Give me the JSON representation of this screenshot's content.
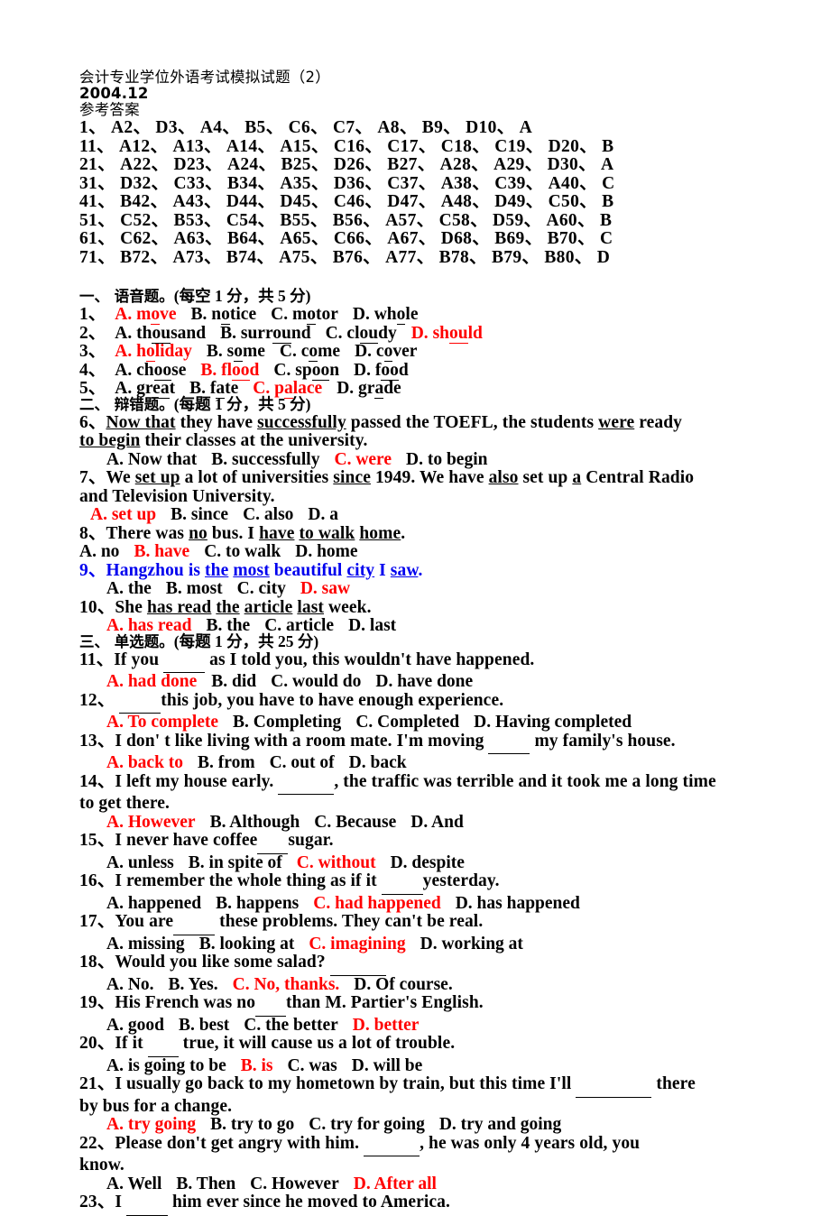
{
  "document": {
    "title": "会计专业学位外语考试模拟试题（2）",
    "date": "2004.12",
    "answer_key_heading": "参考答案"
  },
  "answer_key": {
    "rows": [
      "1、 A2、 D3、 A4、 B5、 C6、 C7、 A8、 B9、 D10、 A",
      "11、 A12、 A13、 A14、 A15、 C16、 C17、 C18、 C19、 D20、 B",
      "21、 A22、 D23、 A24、 B25、 D26、 B27、 A28、 A29、 D30、 A",
      "31、 D32、 C33、 B34、 A35、 D36、 C37、 A38、 C39、 A40、 C",
      "41、 B42、 A43、 D44、 D45、 C46、 D47、 A48、 D49、 C50、 B",
      "51、 C52、 B53、 C54、 B55、 B56、 A57、 C58、 D59、 A60、 B",
      "61、 C62、 A63、 B64、 A65、 C66、 A67、 D68、 B69、 B70、 C",
      "71、 B72、 A73、 B74、 A75、 B76、 A77、 B78、 B79、 B80、 D"
    ]
  },
  "sections": {
    "phonetics": {
      "heading_cn": "一、 语音题。",
      "heading_score": "(每空 1 分，共 5 分)",
      "items": [
        {
          "num": "1、",
          "options": [
            {
              "label": "A.",
              "pre": "m",
              "mark": "o",
              "post": "ve",
              "correct": true
            },
            {
              "label": "B.",
              "pre": "n",
              "mark": "o",
              "post": "tice",
              "correct": false
            },
            {
              "label": "C.",
              "pre": "m",
              "mark": "o",
              "post": "tor",
              "correct": false
            },
            {
              "label": "D.",
              "pre": "wh",
              "mark": "o",
              "post": "le",
              "correct": false
            }
          ]
        },
        {
          "num": "2、",
          "options": [
            {
              "label": "A.",
              "pre": "th",
              "mark": "ou",
              "post": "sand",
              "correct": false
            },
            {
              "label": "B.",
              "pre": "surr",
              "mark": "ou",
              "post": "nd",
              "correct": false
            },
            {
              "label": "C.",
              "pre": "cl",
              "mark": "ou",
              "post": "dy",
              "correct": false
            },
            {
              "label": "D.",
              "pre": "sh",
              "mark": "ou",
              "post": "ld",
              "correct": true
            }
          ]
        },
        {
          "num": "3、",
          "options": [
            {
              "label": "A.",
              "pre": "h",
              "mark": "o",
              "post": "liday",
              "correct": true
            },
            {
              "label": "B.",
              "pre": "s",
              "mark": "o",
              "post": "me",
              "correct": false
            },
            {
              "label": "C.",
              "pre": "c",
              "mark": "o",
              "post": "me",
              "correct": false
            },
            {
              "label": "D.",
              "pre": "c",
              "mark": "o",
              "post": "ver",
              "correct": false
            }
          ]
        },
        {
          "num": "4、",
          "options": [
            {
              "label": "A.",
              "pre": "ch",
              "mark": "oo",
              "post": "se",
              "correct": false
            },
            {
              "label": "B.",
              "pre": "fl",
              "mark": "oo",
              "post": "d",
              "correct": true
            },
            {
              "label": "C.",
              "pre": "sp",
              "mark": "oo",
              "post": "n",
              "correct": false
            },
            {
              "label": "D.",
              "pre": "f",
              "mark": "oo",
              "post": "d",
              "correct": false
            }
          ]
        },
        {
          "num": "5、",
          "options": [
            {
              "label": "A.",
              "pre": "gr",
              "mark": "ea",
              "post": "t",
              "correct": false
            },
            {
              "label": "B.",
              "pre": "f",
              "mark": "a",
              "post": "te",
              "correct": false
            },
            {
              "label": "C.",
              "pre": "p",
              "mark": "a",
              "post": "lace",
              "correct": true
            },
            {
              "label": "D.",
              "pre": "gr",
              "mark": "a",
              "post": "de",
              "correct": false
            }
          ]
        }
      ]
    },
    "error_correction": {
      "heading_cn": "二、 辩错题。",
      "heading_score": "(每题 1 分，共 5 分)",
      "items": [
        {
          "num": "6、",
          "stem_line1_a": "Now that",
          "stem_line1_b": " they have ",
          "stem_line1_c": "successfully",
          "stem_line1_d": " passed the TOEFL, the students  ",
          "stem_line1_e": "were",
          "stem_line1_f": " ready",
          "stem_line2_a": "to begin",
          "stem_line2_b": " their classes at the university.",
          "options": [
            {
              "label": "A.",
              "text": "Now that",
              "correct": false
            },
            {
              "label": "B.",
              "text": "successfully",
              "correct": false
            },
            {
              "label": "C.",
              "text": "were",
              "correct": true
            },
            {
              "label": "D.",
              "text": "to begin",
              "correct": false
            }
          ]
        },
        {
          "num": "7、",
          "stem_line1_a": "We ",
          "stem_line1_b": "set up",
          "stem_line1_c": " a lot of universities ",
          "stem_line1_d": "since",
          "stem_line1_e": " 1949. We have ",
          "stem_line1_f": "also",
          "stem_line1_g": " set up ",
          "stem_line1_h": "a",
          "stem_line1_i": " Central Radio",
          "stem_line2": "and Television University.",
          "options": [
            {
              "label": "A.",
              "text": "set up",
              "correct": true
            },
            {
              "label": "B.",
              "text": "since",
              "correct": false
            },
            {
              "label": "C.",
              "text": "also",
              "correct": false
            },
            {
              "label": "D.",
              "text": "a",
              "correct": false
            }
          ]
        },
        {
          "num": "8、",
          "stem_a": "There was ",
          "stem_b": "no",
          "stem_c": " bus. I ",
          "stem_d": "have",
          "stem_e": " ",
          "stem_f": "to walk",
          "stem_g": " ",
          "stem_h": "home",
          "stem_i": ".",
          "options": [
            {
              "label": "A.",
              "text": "no",
              "correct": false
            },
            {
              "label": "B.",
              "text": "have",
              "correct": true
            },
            {
              "label": "C.",
              "text": "to walk",
              "correct": false
            },
            {
              "label": "D.",
              "text": "home",
              "correct": false
            }
          ]
        },
        {
          "num": "9、",
          "blue": true,
          "stem_a": "Hangzhou is ",
          "stem_b": "the",
          "stem_c": " ",
          "stem_d": "most",
          "stem_e": " beautiful ",
          "stem_f": "city",
          "stem_g": " I ",
          "stem_h": "saw",
          "stem_i": ".",
          "options": [
            {
              "label": "A.",
              "text": "the",
              "correct": false
            },
            {
              "label": "B.",
              "text": "most",
              "correct": false
            },
            {
              "label": "C.",
              "text": "city",
              "correct": false
            },
            {
              "label": "D.",
              "text": "saw",
              "correct": true
            }
          ]
        },
        {
          "num": "10、",
          "stem_a": "She ",
          "stem_b": "has read",
          "stem_c": " ",
          "stem_d": "the",
          "stem_e": " ",
          "stem_f": "article",
          "stem_g": " ",
          "stem_h": "last",
          "stem_i": " week.",
          "options": [
            {
              "label": "A.",
              "text": "has read",
              "correct": true
            },
            {
              "label": "B.",
              "text": "the",
              "correct": false
            },
            {
              "label": "C.",
              "text": "article",
              "correct": false
            },
            {
              "label": "D.",
              "text": "last",
              "correct": false
            }
          ]
        }
      ]
    },
    "multiple_choice": {
      "heading_cn": "三、 单选题。",
      "heading_score": "(每题 1 分，共 25 分)",
      "items": [
        {
          "num": "11、",
          "stem_pre": "If you ",
          "blank": "b-md",
          "stem_post": " as I told you, this wouldn't have happened.",
          "options": [
            {
              "label": "A.",
              "text": "had done",
              "correct": true
            },
            {
              "label": "B.",
              "text": "did",
              "correct": false
            },
            {
              "label": "C.",
              "text": "would do",
              "correct": false
            },
            {
              "label": "D.",
              "text": "have done",
              "correct": false
            }
          ]
        },
        {
          "num": "12、",
          "stem_pre": " ",
          "blank": "b-md",
          "stem_post": "this job, you have to have enough experience.",
          "options": [
            {
              "label": "A.",
              "text": "To complete",
              "correct": true
            },
            {
              "label": "B.",
              "text": "Completing",
              "correct": false
            },
            {
              "label": "C.",
              "text": "Completed",
              "correct": false
            },
            {
              "label": "D.",
              "text": "Having completed",
              "correct": false
            }
          ]
        },
        {
          "num": "13、",
          "stem_pre": "I don' t like living with a room mate. I'm moving ",
          "blank": "b-md",
          "stem_post": " my family's house.",
          "options": [
            {
              "label": "A.",
              "text": "back to",
              "correct": true
            },
            {
              "label": "B.",
              "text": "from",
              "correct": false
            },
            {
              "label": "C.",
              "text": "out of",
              "correct": false
            },
            {
              "label": "D.",
              "text": "back",
              "correct": false
            }
          ]
        },
        {
          "num": "14、",
          "stem_pre": "I left my house early.  ",
          "blank": "b-lg",
          "stem_post": ", the traffic was terrible and it took me a long time",
          "stem_line2": "to get there.",
          "options": [
            {
              "label": "A.",
              "text": "However",
              "correct": true
            },
            {
              "label": "B.",
              "text": "Although",
              "correct": false
            },
            {
              "label": "C.",
              "text": "Because",
              "correct": false
            },
            {
              "label": "D.",
              "text": "And",
              "correct": false
            }
          ]
        },
        {
          "num": "15、",
          "stem_pre": "I never have coffee",
          "blank": "b-sm",
          "stem_post": "sugar.",
          "options": [
            {
              "label": "A.",
              "text": "unless",
              "correct": false
            },
            {
              "label": "B.",
              "text": "in spite of",
              "correct": false
            },
            {
              "label": "C.",
              "text": "without",
              "correct": true
            },
            {
              "label": "D.",
              "text": "despite",
              "correct": false
            }
          ]
        },
        {
          "num": "16、",
          "stem_pre": "I remember the whole thing as if it ",
          "blank": "b-md",
          "stem_post": "yesterday.",
          "options": [
            {
              "label": "A.",
              "text": "happened",
              "correct": false
            },
            {
              "label": "B.",
              "text": "happens",
              "correct": false
            },
            {
              "label": "C.",
              "text": "had happened",
              "correct": true
            },
            {
              "label": "D.",
              "text": "has happened",
              "correct": false
            }
          ]
        },
        {
          "num": "17、",
          "stem_pre": "You are",
          "blank": "b-md",
          "stem_post": " these problems. They can't be real.",
          "options": [
            {
              "label": "A.",
              "text": "missing",
              "correct": false
            },
            {
              "label": "B.",
              "text": "looking at",
              "correct": false
            },
            {
              "label": "C.",
              "text": "imagining",
              "correct": true
            },
            {
              "label": "D.",
              "text": "working at",
              "correct": false
            }
          ]
        },
        {
          "num": "18、",
          "stem_pre": "Would you like some salad? ",
          "blank": "b-lg",
          "stem_post": "",
          "options": [
            {
              "label": "A.",
              "text": "No.",
              "correct": false
            },
            {
              "label": "B.",
              "text": "Yes.",
              "correct": false
            },
            {
              "label": "C.",
              "text": "No, thanks.",
              "correct": true
            },
            {
              "label": "D.",
              "text": "Of course.",
              "correct": false
            }
          ]
        },
        {
          "num": "19、",
          "stem_pre": "His French was no",
          "blank": "b-sm",
          "stem_post": "than M. Partier's English.",
          "options": [
            {
              "label": "A.",
              "text": "good",
              "correct": false
            },
            {
              "label": "B.",
              "text": "best",
              "correct": false
            },
            {
              "label": "C.",
              "text": "the better",
              "correct": false
            },
            {
              "label": "D.",
              "text": "better",
              "correct": true
            }
          ]
        },
        {
          "num": "20、",
          "stem_pre": "If it ",
          "blank": "b-sm",
          "stem_post": " true, it will cause us a lot of trouble.",
          "options": [
            {
              "label": "A.",
              "text": "is going to be",
              "correct": false
            },
            {
              "label": "B.",
              "text": "is",
              "correct": true
            },
            {
              "label": "C.",
              "text": "was",
              "correct": false
            },
            {
              "label": "D.",
              "text": "will be",
              "correct": false
            }
          ]
        },
        {
          "num": "21、",
          "stem_pre": "I usually go back to my hometown by train, but this time I'll ",
          "blank": "b-xl",
          "stem_post": " there",
          "stem_line2": "by bus for a change.",
          "options": [
            {
              "label": "A.",
              "text": "try going",
              "correct": true
            },
            {
              "label": "B.",
              "text": "try to go",
              "correct": false
            },
            {
              "label": "C.",
              "text": "try for going",
              "correct": false
            },
            {
              "label": "D.",
              "text": "try and going",
              "correct": false
            }
          ]
        },
        {
          "num": "22、",
          "stem_pre": "Please  don't  get  angry  with  him.  ",
          "blank": "b-lg",
          "stem_post": ",  he  was  only  4  years  old,  you",
          "stem_line2": "know.",
          "options": [
            {
              "label": "A.",
              "text": "Well",
              "correct": false
            },
            {
              "label": "B.",
              "text": "Then",
              "correct": false
            },
            {
              "label": "C.",
              "text": "However",
              "correct": false
            },
            {
              "label": "D.",
              "text": "After all",
              "correct": true
            }
          ]
        },
        {
          "num": "23、",
          "stem_pre": "I ",
          "blank": "b-md",
          "stem_post": " him ever since he moved to America.",
          "options": []
        }
      ]
    }
  }
}
